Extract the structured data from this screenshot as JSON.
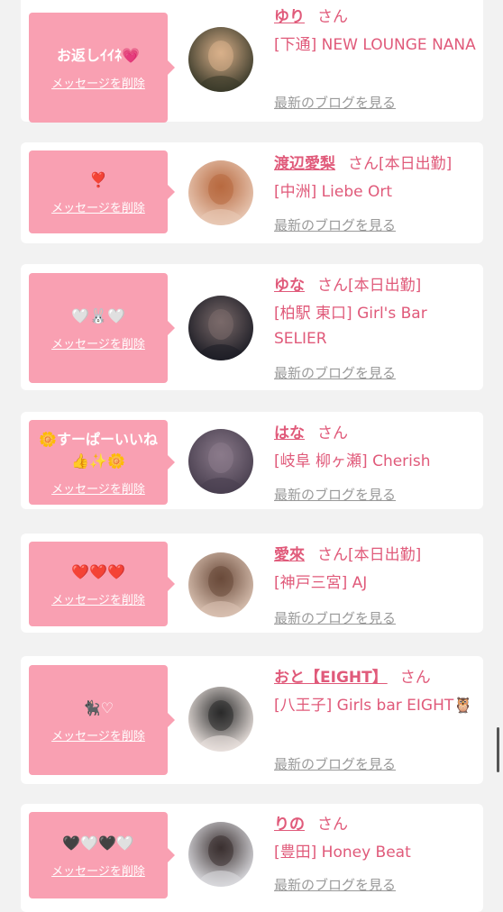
{
  "delete_label": "メッセージを削除",
  "blog_label": "最新のブログを見る",
  "san_label": "さん",
  "entries": [
    {
      "message": "お返しｲｲﾈ💗",
      "name": "ゆり",
      "status": "",
      "shop": "[下通] NEW LOUNGE NANA",
      "avatar_colors": [
        "#3a3a2a",
        "#d9b08a"
      ]
    },
    {
      "message": "❣️",
      "name": "渡辺愛梨",
      "status": "[本日出勤]",
      "shop": "[中洲] Liebe Ort",
      "avatar_colors": [
        "#e8c8b4",
        "#b86a40"
      ]
    },
    {
      "message": "🤍🐰🤍",
      "name": "ゆな",
      "status": "[本日出勤]",
      "shop": "[柏駅 東口] Girl's Bar SELIER",
      "avatar_colors": [
        "#1e1e26",
        "#7a6a6a"
      ]
    },
    {
      "message": "🌼すーぱーいいね\n👍✨🌼",
      "name": "はな",
      "status": "",
      "shop": "[岐阜 柳ヶ瀬] Cherish",
      "avatar_colors": [
        "#4a4050",
        "#8a7a8a"
      ]
    },
    {
      "message": "❤️❤️❤️",
      "name": "愛來",
      "status": "[本日出勤]",
      "shop": "[神戸三宮] AJ",
      "avatar_colors": [
        "#d8c0b0",
        "#6a4a3a"
      ]
    },
    {
      "message": "🐈‍⬛♡",
      "name": "おと【EIGHT】",
      "status": "",
      "shop": "[八王子] Girls bar EIGHT🦉",
      "avatar_colors": [
        "#e8e0dc",
        "#2a2a2a"
      ]
    },
    {
      "message": "🖤🤍🖤🤍",
      "name": "りの",
      "status": "",
      "shop": "[豊田] Honey Beat",
      "avatar_colors": [
        "#d8d8dc",
        "#3a3030"
      ]
    }
  ]
}
